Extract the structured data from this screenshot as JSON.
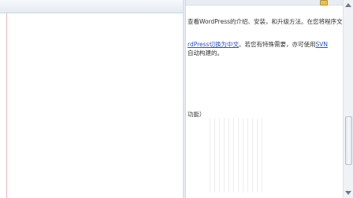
{
  "doc": {
    "line1": "查看WordPress的介绍、安装，和升级方法。在您将程序文",
    "line2_link1": "rdPress切换为中文",
    "line2_text": "。若您有特殊需要，亦可使用",
    "line2_link2": "SVN",
    "line3": "自动构建的。",
    "line4": "功能）"
  },
  "colors": {
    "link": "#2a55c4",
    "text": "#333333"
  }
}
